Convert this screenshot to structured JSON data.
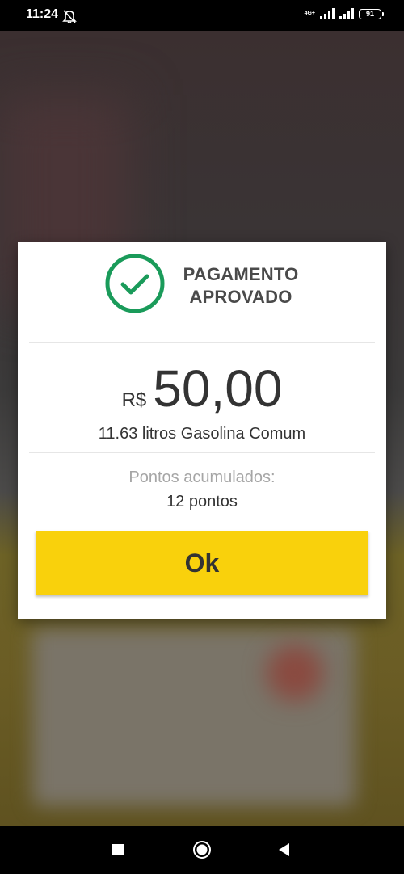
{
  "status_bar": {
    "time": "11:24",
    "network": "4G+",
    "battery": "91",
    "icons": [
      "alarm-off-icon",
      "signal-icon",
      "signal-icon",
      "battery-icon"
    ]
  },
  "dialog": {
    "title_line1": "PAGAMENTO",
    "title_line2": "APROVADO",
    "icon": "check-circle-icon",
    "currency": "R$",
    "amount": "50,00",
    "fuel_description": "11.63 litros Gasolina Comum",
    "points_label": "Pontos acumulados:",
    "points_value": "12 pontos",
    "ok_label": "Ok"
  },
  "nav_bar": {
    "icons": [
      "recents-square-icon",
      "home-circle-icon",
      "back-triangle-icon"
    ]
  },
  "colors": {
    "accent_green": "#1a9b5a",
    "button_yellow": "#f9d10c",
    "text_dark": "#333333",
    "text_muted": "#a6a6a6"
  }
}
